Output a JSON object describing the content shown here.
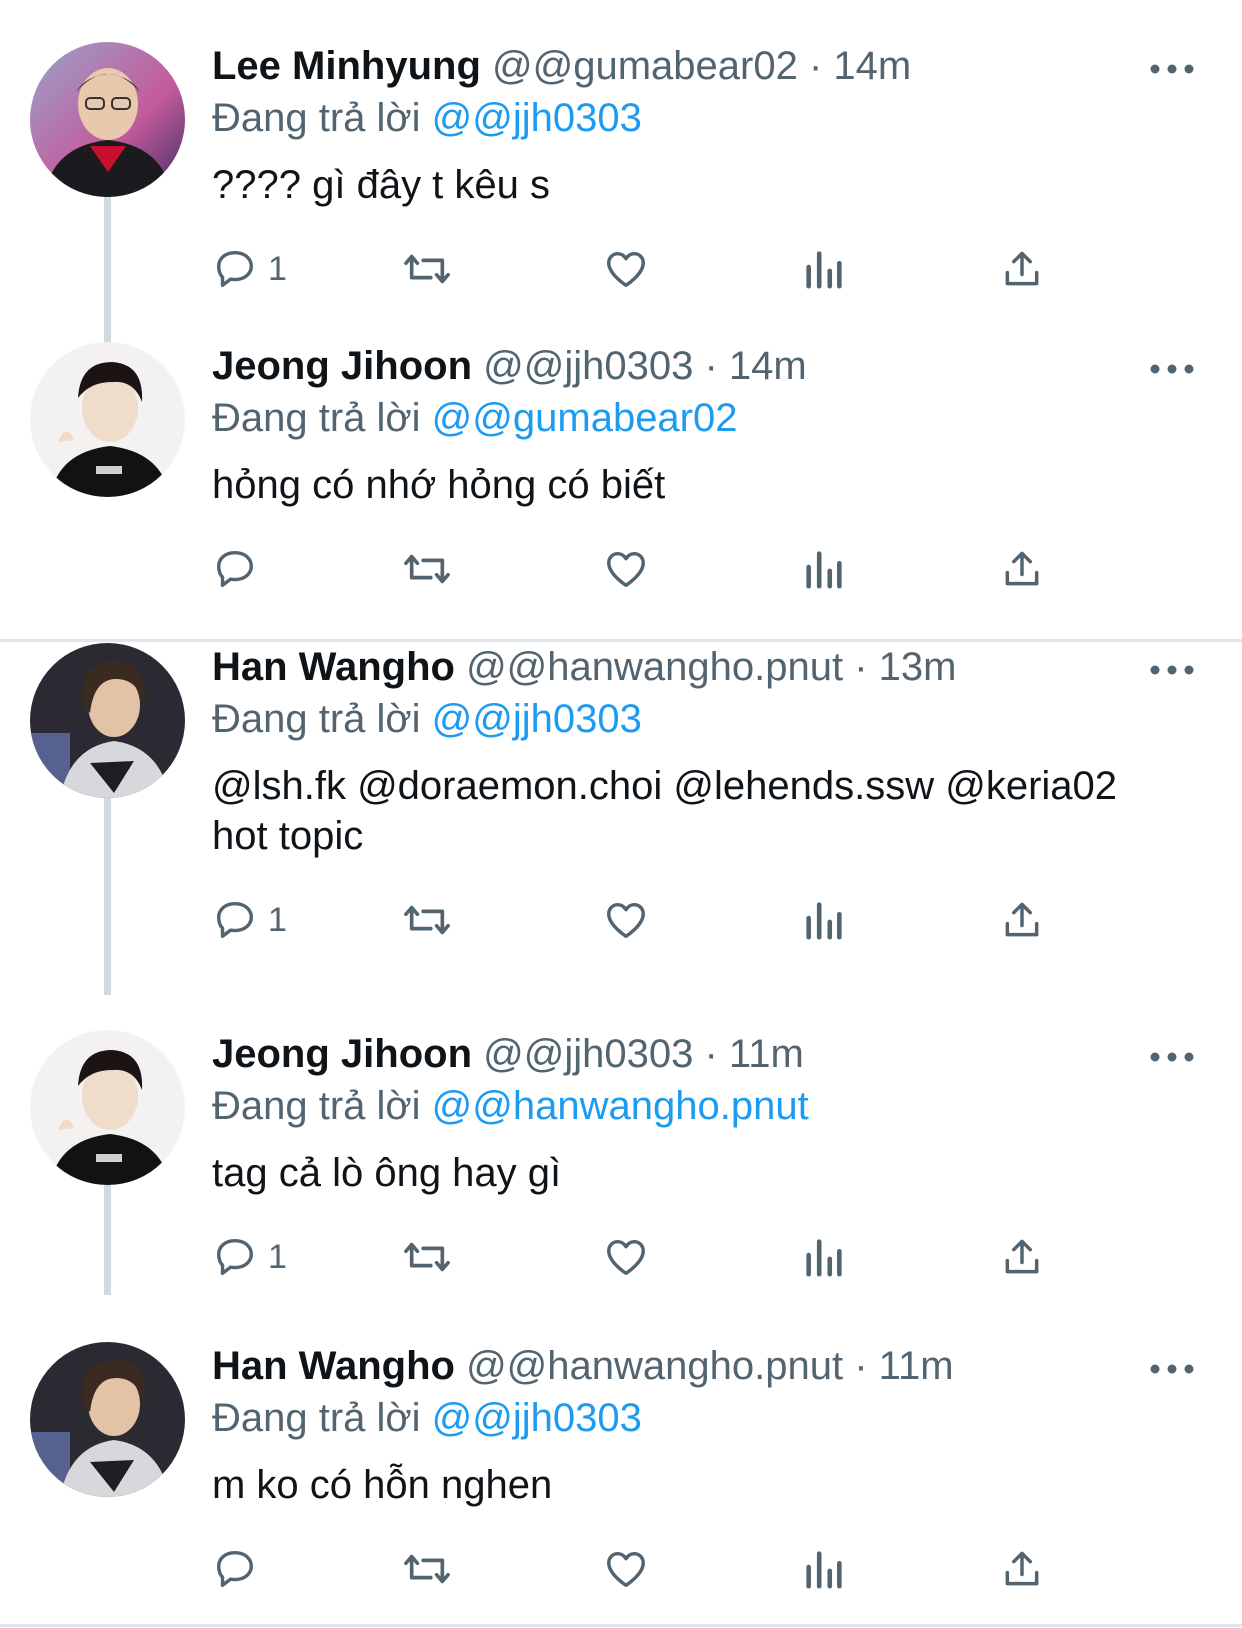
{
  "tweets": [
    {
      "name": "Lee Minhyung",
      "handle": "@@gumabear02",
      "time": "14m",
      "reply_prefix": "Đang trả lời",
      "reply_to": "@@jjh0303",
      "text_mentions": "",
      "text": "???? gì đây t kêu s",
      "reply_count": "1"
    },
    {
      "name": "Jeong Jihoon",
      "handle": "@@jjh0303",
      "time": "14m",
      "reply_prefix": "Đang trả lời",
      "reply_to": "@@gumabear02",
      "text_mentions": "",
      "text": "hỏng có nhớ hỏng có biết",
      "reply_count": ""
    },
    {
      "name": "Han Wangho",
      "handle": "@@hanwangho.pnut",
      "time": "13m",
      "reply_prefix": "Đang trả lời",
      "reply_to": "@@jjh0303",
      "text_mentions": "@lsh.fk @doraemon.choi @lehends.ssw @keria02",
      "text": "hot topic",
      "reply_count": "1"
    },
    {
      "name": "Jeong Jihoon",
      "handle": "@@jjh0303",
      "time": "11m",
      "reply_prefix": "Đang trả lời",
      "reply_to": "@@hanwangho.pnut",
      "text_mentions": "",
      "text": "tag cả lò ông hay gì",
      "reply_count": "1"
    },
    {
      "name": "Han Wangho",
      "handle": "@@hanwangho.pnut",
      "time": "11m",
      "reply_prefix": "Đang trả lời",
      "reply_to": "@@jjh0303",
      "text_mentions": "",
      "text": "m ko có hỗn nghen",
      "reply_count": ""
    }
  ],
  "colors": {
    "link": "#1d9bf0",
    "secondary_text": "#536471",
    "icon": "#536471",
    "thread_line": "#cfd9de"
  },
  "icons": [
    "reply-icon",
    "retweet-icon",
    "like-icon",
    "views-icon",
    "share-icon",
    "more-icon"
  ]
}
